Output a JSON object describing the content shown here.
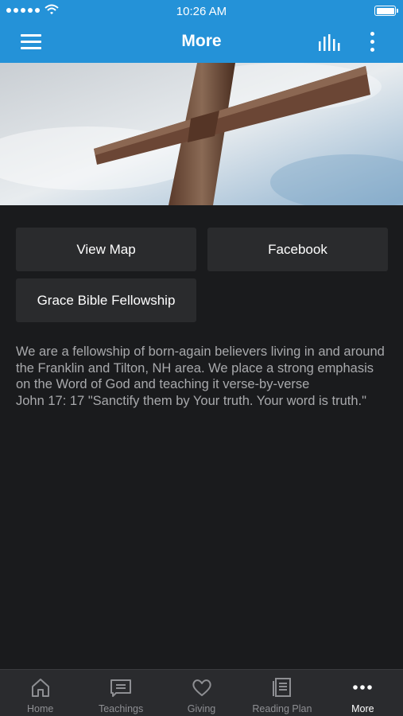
{
  "status_bar": {
    "time": "10:26 AM"
  },
  "nav": {
    "title": "More"
  },
  "actions": {
    "view_map": "View Map",
    "facebook": "Facebook",
    "church_name": "Grace Bible Fellowship"
  },
  "description": "We are a fellowship of born-again believers living in and around the Franklin and Tilton, NH area. We place a strong emphasis on the Word of God and teaching it verse-by-verse\nJohn 17: 17 \"Sanctify them by Your truth. Your word is truth.\"",
  "tabs": [
    {
      "label": "Home",
      "icon": "home-icon"
    },
    {
      "label": "Teachings",
      "icon": "message-icon"
    },
    {
      "label": "Giving",
      "icon": "heart-icon"
    },
    {
      "label": "Reading Plan",
      "icon": "book-icon"
    },
    {
      "label": "More",
      "icon": "more-horizontal-icon",
      "active": true
    }
  ],
  "colors": {
    "accent": "#2492d8",
    "background": "#1a1b1d",
    "button": "#2a2b2d",
    "tabbar": "#2a2b2e"
  }
}
